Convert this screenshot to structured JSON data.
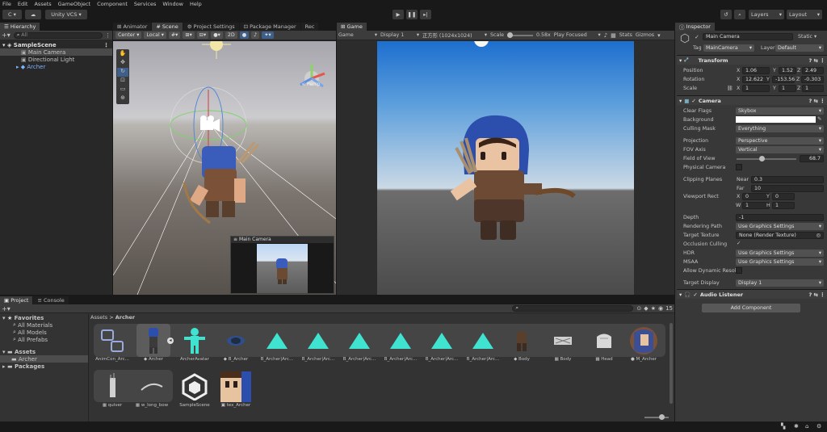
{
  "menu": [
    "File",
    "Edit",
    "Assets",
    "GameObject",
    "Component",
    "Services",
    "Window",
    "Help"
  ],
  "toolbar": {
    "account": "C",
    "vcs": "Unity VCS",
    "layers": "Layers",
    "layout": "Layout"
  },
  "hierarchy": {
    "tab": "Hierarchy",
    "search": "All",
    "scene": "SampleScene",
    "items": [
      "Main Camera",
      "Directional Light",
      "Archer"
    ]
  },
  "center_tabs": [
    "Animator",
    "Scene",
    "Project Settings",
    "Package Manager",
    "Rec"
  ],
  "scene_bar": {
    "pivot": "Center",
    "space": "Local",
    "mode2d": "2D"
  },
  "scene_view": {
    "persp": "< Persp",
    "preview_title": "Main Camera"
  },
  "game": {
    "tab": "Game",
    "display_mode": "Game",
    "display": "Display 1",
    "aspect": "正方形 (1024x1024)",
    "scale_label": "Scale",
    "scale_value": "0.58x",
    "play_focused": "Play Focused",
    "stats": "Stats",
    "gizmos": "Gizmos"
  },
  "inspector": {
    "tab": "Inspector",
    "object_name": "Main Camera",
    "static": "Static",
    "tag_label": "Tag",
    "tag": "MainCamera",
    "layer_label": "Layer",
    "layer": "Default",
    "transform": {
      "title": "Transform",
      "position_label": "Position",
      "rotation_label": "Rotation",
      "scale_label": "Scale",
      "pos": {
        "x": "1.06",
        "y": "1.52",
        "z": "2.49"
      },
      "rot": {
        "x": "12.622",
        "y": "-153.56",
        "z": "-0.303"
      },
      "scl": {
        "x": "1",
        "y": "1",
        "z": "1"
      }
    },
    "camera": {
      "title": "Camera",
      "rows": [
        {
          "label": "Clear Flags",
          "value": "Skybox"
        },
        {
          "label": "Background",
          "value": ""
        },
        {
          "label": "Culling Mask",
          "value": "Everything"
        },
        {
          "label": "Projection",
          "value": "Perspective"
        },
        {
          "label": "FOV Axis",
          "value": "Vertical"
        },
        {
          "label": "Field of View",
          "value": "68.7"
        },
        {
          "label": "Physical Camera",
          "value": ""
        },
        {
          "label": "Clipping Planes",
          "value": ""
        },
        {
          "label": "Viewport Rect",
          "value": ""
        },
        {
          "label": "Depth",
          "value": "-1"
        },
        {
          "label": "Rendering Path",
          "value": "Use Graphics Settings"
        },
        {
          "label": "Target Texture",
          "value": "None (Render Texture)"
        },
        {
          "label": "Occlusion Culling",
          "value": "✓"
        },
        {
          "label": "HDR",
          "value": "Use Graphics Settings"
        },
        {
          "label": "MSAA",
          "value": "Use Graphics Settings"
        },
        {
          "label": "Allow Dynamic Resol",
          "value": ""
        },
        {
          "label": "Target Display",
          "value": "Display 1"
        }
      ],
      "near_label": "Near",
      "near": "0.3",
      "far_label": "Far",
      "far": "10",
      "vx": "0",
      "vy": "0",
      "vw": "1",
      "vh": "1"
    },
    "audio_listener": "Audio Listener",
    "add_component": "Add Component"
  },
  "project": {
    "tabs": [
      "Project",
      "Console"
    ],
    "count": "15",
    "favorites": "Favorites",
    "fav_items": [
      "All Materials",
      "All Models",
      "All Prefabs"
    ],
    "assets_label": "Assets",
    "archer_folder": "Archer",
    "packages": "Packages",
    "breadcrumb": [
      "Assets",
      "Archer"
    ],
    "assets": [
      "AnimCon_Arc...",
      "Archer",
      "ArcherAvatar",
      "B_Archer",
      "B_Archer|Arc...",
      "B_Archer|Arc...",
      "B_Archer|Arc...",
      "B_Archer|Arc...",
      "B_Archer|Arc...",
      "B_Archer|Arc...",
      "Body",
      "Body",
      "Head",
      "M_Archer",
      "quiver",
      "w_long_bow",
      "SampleScene",
      "tex_Archer"
    ]
  }
}
